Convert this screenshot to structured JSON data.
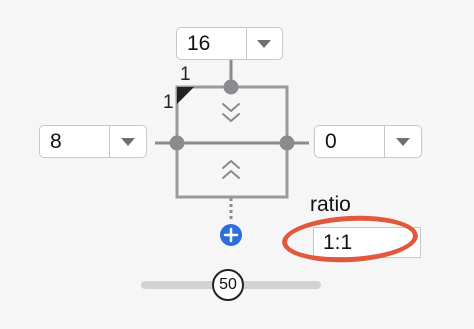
{
  "top_combo": {
    "value": "16"
  },
  "left_combo": {
    "value": "8"
  },
  "right_combo": {
    "value": "0"
  },
  "corner_labels": {
    "top": "1",
    "left": "1"
  },
  "ratio": {
    "label": "ratio",
    "value": "1:1"
  },
  "slider": {
    "value": "50",
    "fraction": 0.5
  },
  "colors": {
    "handle_gray": "#8a8a8f",
    "add_blue": "#2a6fdb",
    "highlight_orange": "#e2583e",
    "frame_gray": "#9a9a9a"
  },
  "icons": {
    "add": "plus-circle-icon",
    "collapse": "chevron-double-down-icon",
    "expand": "chevron-double-up-icon",
    "dropdown": "chevron-down-icon"
  }
}
